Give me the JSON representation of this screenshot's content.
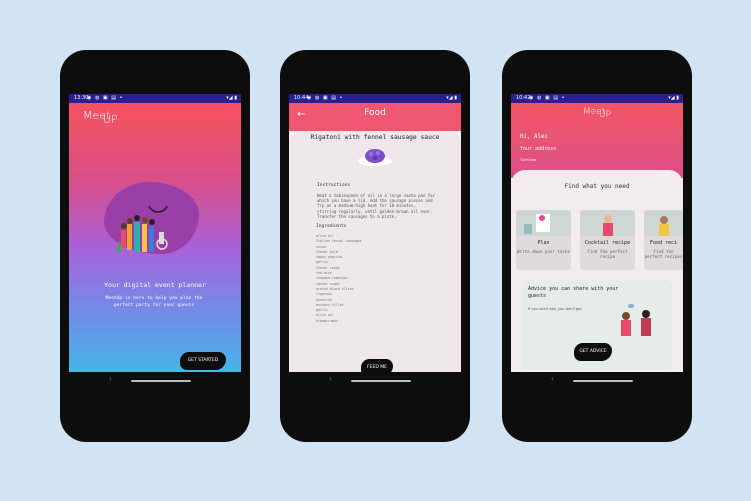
{
  "phone1": {
    "status": {
      "time": "13:30",
      "icons": "◉ ◍ ▣ ▤ •",
      "right": "▾◢ ▮"
    },
    "logo": {
      "meet": "Meet",
      "up": "UP"
    },
    "tagline": "Your digital event planner",
    "description": "MeetUp is here to help you plan the perfect party for your guests",
    "cta": "GET STARTED"
  },
  "phone2": {
    "status": {
      "time": "10:44",
      "icons": "◉ ◍ ▣ ▤ •",
      "right": "▾◢ ▮"
    },
    "back_icon": "←",
    "title": "Food",
    "recipe_title": "Rigatoni with fennel sausage sauce",
    "instructions_label": "Instructions",
    "instructions": "Heat a tablespoon of oil in a large saute pan for which you have a lid. Add the sausage pieces and fry on a medium-high heat for 10 minutes, stirring regularly, until golden-brown all over. Transfer the sausages to a plate,",
    "ingredients_label": "Ingredients",
    "ingredients": [
      "olive oil",
      "Italian fennel sausages",
      "onion",
      "fennel bulb",
      "smoky paprika",
      "garlic",
      "fennel seeds",
      "red wine",
      "chopped tomatoes",
      "caster sugar",
      "grated black olives",
      "rigatoni",
      "pecorino",
      "anchovy fillet",
      "garlic",
      "olive oil",
      "breadcrumbs"
    ],
    "cta": "FEED ME"
  },
  "phone3": {
    "status": {
      "time": "10:42",
      "icons": "◉ ◍ ▣ ▤ •",
      "right": "▾◢ ▮"
    },
    "logo": {
      "meet": "Meet",
      "up": "UP"
    },
    "greeting": "Hi, Alec",
    "address_label": "Your address",
    "address_value": "Tottham",
    "find_heading": "Find what you need",
    "tiles": [
      {
        "title": "Plan",
        "subtitle": "Write down your tasks"
      },
      {
        "title": "Cocktail recipe",
        "subtitle": "Find the perfect recipe"
      },
      {
        "title": "Food reci",
        "subtitle": "Find the perfect recipes"
      }
    ],
    "advice_heading": "Advice you can share with your guests",
    "advice_quote": "If you don't ask, you don't get",
    "cta": "GET ADVICE"
  },
  "colors": {
    "background": "#d2e3f3",
    "brand_red": "#f0566f",
    "status_bar": "#2b1f8f",
    "gradient_end": "#39c0e6"
  }
}
